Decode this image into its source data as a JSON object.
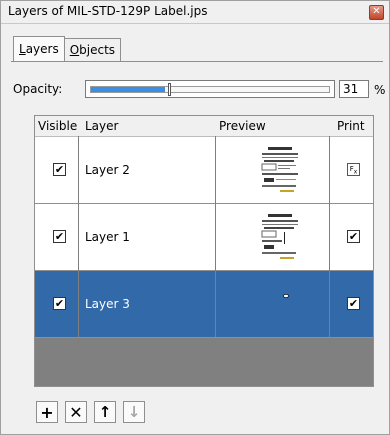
{
  "window": {
    "title": "Layers of MIL-STD-129P Label.jps",
    "close_glyph": "✕"
  },
  "tabs": [
    {
      "label": "Layers",
      "underline": "L",
      "rest": "ayers"
    },
    {
      "label": "Objects",
      "underline": "O",
      "rest": "bjects"
    }
  ],
  "opacity": {
    "label": "Opacity:",
    "value": "31",
    "unit": "%",
    "fraction": 0.31
  },
  "table": {
    "columns": [
      "Visible",
      "Layer",
      "Preview",
      "Print"
    ],
    "rows": [
      {
        "name": "Layer 2",
        "visible": true,
        "print": "fx",
        "selected": false
      },
      {
        "name": "Layer 1",
        "visible": true,
        "print": "checked",
        "selected": false
      },
      {
        "name": "Layer 3",
        "visible": true,
        "print": "checked",
        "selected": true
      }
    ]
  },
  "toolbar": [
    {
      "icon": "plus-icon",
      "glyph": "+",
      "enabled": true
    },
    {
      "icon": "delete-x-icon",
      "glyph": "✕",
      "enabled": true
    },
    {
      "icon": "arrow-up-icon",
      "glyph": "↑",
      "enabled": true
    },
    {
      "icon": "arrow-down-icon",
      "glyph": "↓",
      "enabled": false
    }
  ],
  "colors": {
    "selection": "#326aa9",
    "slider_fill": "#3a8ee6",
    "empty_area": "#808080"
  }
}
